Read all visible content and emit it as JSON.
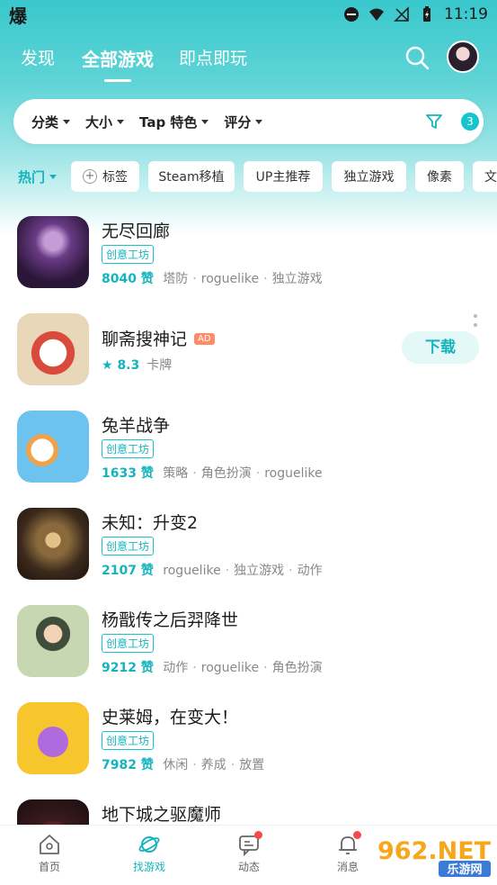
{
  "status_bar": {
    "app_glyph": "爆",
    "time": "11:19"
  },
  "header": {
    "tabs": [
      {
        "label": "发现",
        "active": false
      },
      {
        "label": "全部游戏",
        "active": true
      },
      {
        "label": "即点即玩",
        "active": false
      }
    ]
  },
  "filters": {
    "items": [
      "分类",
      "大小",
      "Tap 特色",
      "评分"
    ],
    "count": "3"
  },
  "chips": {
    "hot": "热门",
    "tag": "标签",
    "items": [
      "Steam移植",
      "UP主推荐",
      "独立游戏",
      "像素",
      "文"
    ]
  },
  "games": [
    {
      "title": "无尽回廊",
      "badge": "创意工坊",
      "likes": "8040 赞",
      "tags": [
        "塔防",
        "roguelike",
        "独立游戏"
      ]
    },
    {
      "title": "聊斋搜神记",
      "ad": "AD",
      "rating": "8.3",
      "tags": [
        "卡牌"
      ],
      "action": "下载"
    },
    {
      "title": "兔羊战争",
      "badge": "创意工坊",
      "likes": "1633 赞",
      "tags": [
        "策略",
        "角色扮演",
        "roguelike"
      ]
    },
    {
      "title": "未知：升变2",
      "badge": "创意工坊",
      "likes": "2107 赞",
      "tags": [
        "roguelike",
        "独立游戏",
        "动作"
      ]
    },
    {
      "title": "杨戬传之后羿降世",
      "badge": "创意工坊",
      "likes": "9212 赞",
      "tags": [
        "动作",
        "roguelike",
        "角色扮演"
      ]
    },
    {
      "title": "史莱姆，在变大！",
      "badge": "创意工坊",
      "likes": "7982 赞",
      "tags": [
        "休闲",
        "养成",
        "放置"
      ]
    },
    {
      "title": "地下城之驱魔师"
    }
  ],
  "bottom_nav": [
    {
      "label": "首页",
      "icon": "home-icon"
    },
    {
      "label": "找游戏",
      "icon": "planet-icon",
      "active": true
    },
    {
      "label": "动态",
      "icon": "chat-icon",
      "dot": true
    },
    {
      "label": "消息",
      "icon": "bell-icon",
      "dot": true
    }
  ],
  "watermark": {
    "text": "962.NET",
    "sub": "乐游网"
  },
  "colors": {
    "accent": "#15c5ce",
    "header_gradient_top": "#39c8cc",
    "ad_badge": "#ff8b68",
    "notify_dot": "#f7484e"
  }
}
